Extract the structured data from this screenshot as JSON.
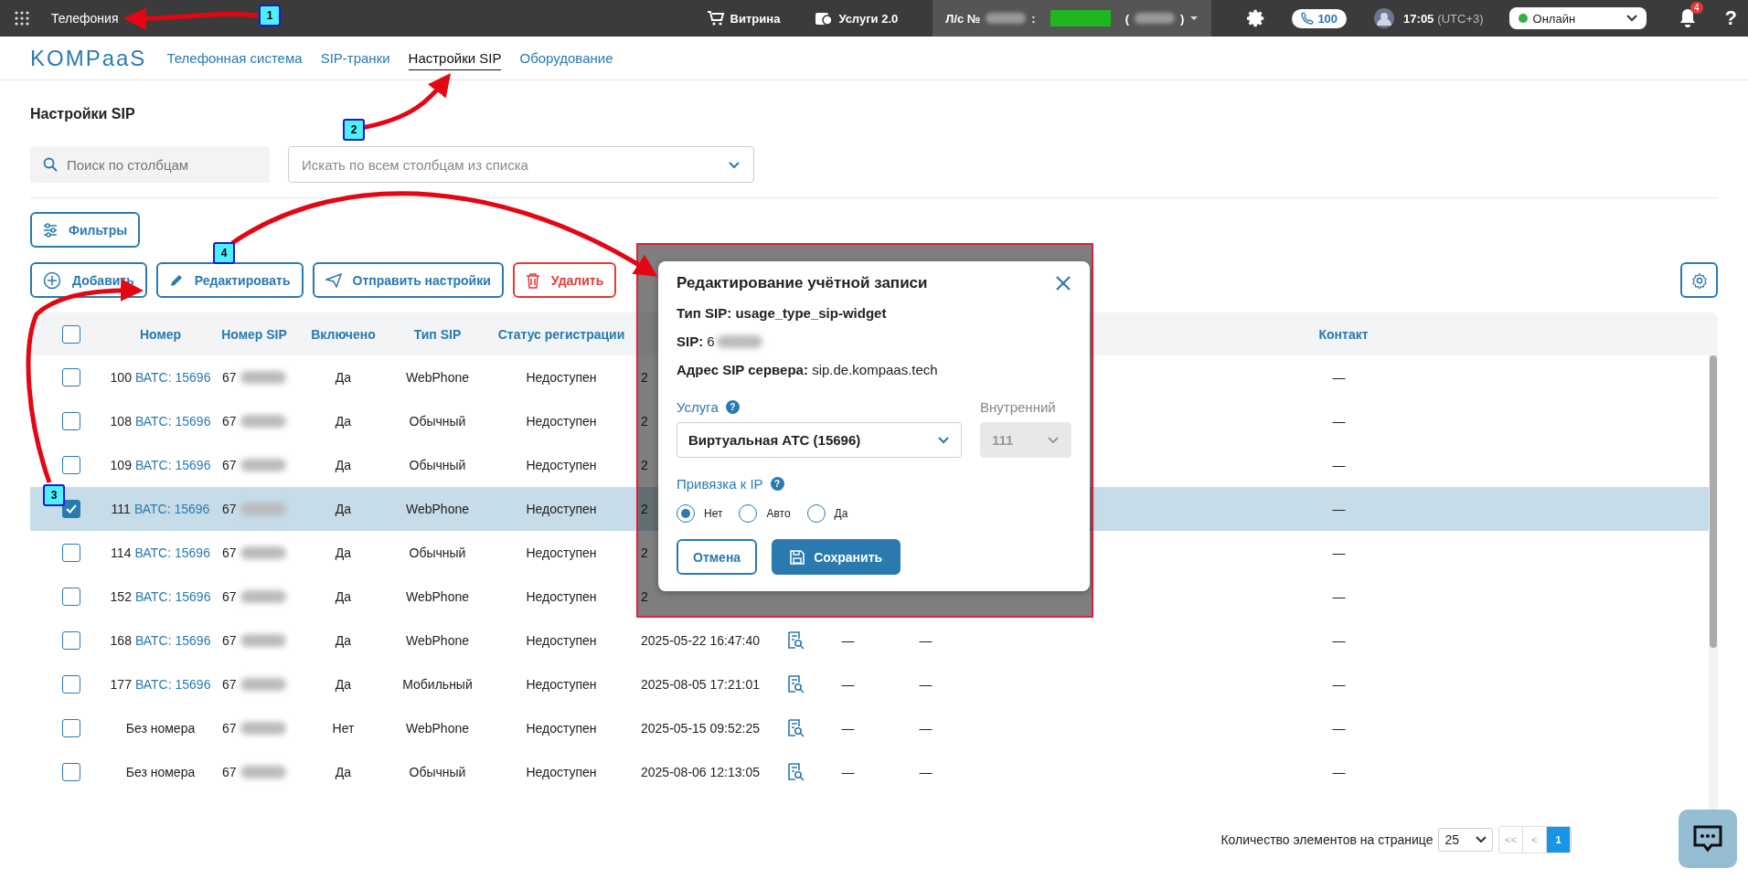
{
  "topbar": {
    "app_title": "Телефония",
    "shop": "Витрина",
    "services": "Услуги 2.0",
    "account_label": "Л/с №",
    "account_sep": ":",
    "account_paren_open": "(",
    "account_paren_close": ")",
    "phone_count": "100",
    "time": "17:05",
    "timezone": "(UTC+3)",
    "status": "Онлайн",
    "notifications": "4",
    "help": "?"
  },
  "nav": {
    "logo": "KOMPaaS",
    "tabs": [
      {
        "label": "Телефонная система",
        "selected": false
      },
      {
        "label": "SIP-транки",
        "selected": false
      },
      {
        "label": "Настройки SIP",
        "selected": true
      },
      {
        "label": "Оборудование",
        "selected": false
      }
    ]
  },
  "page_title": "Настройки SIP",
  "search": {
    "placeholder": "Поиск по столбцам",
    "scope_placeholder": "Искать по всем столбцам из списка"
  },
  "filters_button": "Фильтры",
  "actions": [
    {
      "kind": "add",
      "label": "Добавить"
    },
    {
      "kind": "edit",
      "label": "Редактировать"
    },
    {
      "kind": "send",
      "label": "Отправить настройки"
    },
    {
      "kind": "delete",
      "label": "Удалить"
    }
  ],
  "table": {
    "columns": [
      "Номер",
      "Номер SIP",
      "Включено",
      "Тип SIP",
      "Статус регистрации"
    ],
    "contact_column": "Контакт",
    "header_checked": false,
    "rows": [
      {
        "selected": false,
        "number": "100",
        "link": "ВАТС: 15696",
        "sip": "67",
        "enabled": "Да",
        "type": "WebPhone",
        "status": "Недоступен",
        "date": "2",
        "contact": "—"
      },
      {
        "selected": false,
        "number": "108",
        "link": "ВАТС: 15696",
        "sip": "67",
        "enabled": "Да",
        "type": "Обычный",
        "status": "Недоступен",
        "date": "2",
        "contact": "—"
      },
      {
        "selected": false,
        "number": "109",
        "link": "ВАТС: 15696",
        "sip": "67",
        "enabled": "Да",
        "type": "Обычный",
        "status": "Недоступен",
        "date": "2",
        "contact": "—"
      },
      {
        "selected": true,
        "number": "111",
        "link": "ВАТС: 15696",
        "sip": "67",
        "enabled": "Да",
        "type": "WebPhone",
        "status": "Недоступен",
        "date": "2",
        "contact": "—"
      },
      {
        "selected": false,
        "number": "114",
        "link": "ВАТС: 15696",
        "sip": "67",
        "enabled": "Да",
        "type": "Обычный",
        "status": "Недоступен",
        "date": "2",
        "contact": "—"
      },
      {
        "selected": false,
        "number": "152",
        "link": "ВАТС: 15696",
        "sip": "67",
        "enabled": "Да",
        "type": "WebPhone",
        "status": "Недоступен",
        "date": "2",
        "contact": "—"
      },
      {
        "selected": false,
        "number": "168",
        "link": "ВАТС: 15696",
        "sip": "67",
        "enabled": "Да",
        "type": "WebPhone",
        "status": "Недоступен",
        "date": "2025-05-22 16:47:40",
        "column_8": "—",
        "column_9": "—",
        "contact": "—"
      },
      {
        "selected": false,
        "number": "177",
        "link": "ВАТС: 15696",
        "sip": "67",
        "enabled": "Да",
        "type": "Мобильный",
        "status": "Недоступен",
        "date": "2025-08-05 17:21:01",
        "column_8": "—",
        "column_9": "—",
        "contact": "—"
      },
      {
        "selected": false,
        "number": "Без номера",
        "sip": "67",
        "enabled": "Нет",
        "type": "WebPhone",
        "status": "Недоступен",
        "date": "2025-05-15 09:52:25",
        "column_8": "—",
        "column_9": "—",
        "contact": "—"
      },
      {
        "selected": false,
        "number": "Без номера",
        "sip": "67",
        "enabled": "Да",
        "type": "Обычный",
        "status": "Недоступен",
        "date": "2025-08-06 12:13:05",
        "column_8": "—",
        "column_9": "—",
        "contact": "—"
      }
    ]
  },
  "pagination": {
    "label": "Количество элементов на странице",
    "page_size": "25",
    "first": "<<",
    "prev": "<",
    "pages": [
      {
        "label": "1",
        "selected": true
      }
    ]
  },
  "dialog": {
    "title": "Редактирование учётной записи",
    "lines": [
      "**Тип SIP: usage_type_sip-widget**",
      "**SIP:** 6",
      "**Адрес SIP сервера:** sip.de.kompaas.tech"
    ],
    "service_label": "Услуга",
    "service_help": "?",
    "ip_help": "?",
    "service_value": "Виртуальная АТС (15696)",
    "internal_label": "Внутренний",
    "internal_value": "111",
    "ip_label": "Привязка к IP",
    "ip_options": [
      {
        "label": "Нет",
        "selected": true
      },
      {
        "label": "Авто",
        "selected": false
      },
      {
        "label": "Да",
        "selected": false
      }
    ],
    "cancel": "Отмена",
    "save": "Сохранить"
  },
  "annotations": [
    {
      "label": "1"
    },
    {
      "label": "2"
    },
    {
      "label": "3"
    },
    {
      "label": "4"
    }
  ]
}
